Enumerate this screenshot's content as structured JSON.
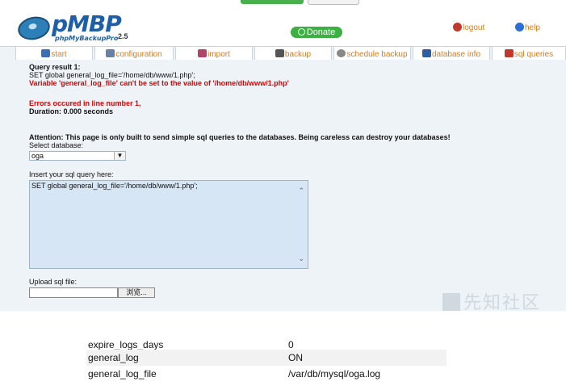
{
  "app": {
    "logo_name": "pMBP",
    "logo_sub": "phpMyBackupPro",
    "version": "2.5",
    "donate_label": "Donate",
    "logout_label": "logout",
    "help_label": "help"
  },
  "tabs": [
    {
      "label": "start"
    },
    {
      "label": "configuration"
    },
    {
      "label": "import"
    },
    {
      "label": "backup"
    },
    {
      "label": "schedule backup"
    },
    {
      "label": "database info"
    },
    {
      "label": "sql queries"
    }
  ],
  "result": {
    "title": "Query result 1:",
    "query": "SET global general_log_file='/home/db/www/1.php';",
    "error_msg": "Variable 'general_log_file' can't be set to the value of '/home/db/www/1.php'",
    "errors_line": "Errors occured in line number 1,",
    "duration": "Duration: 0.000 seconds"
  },
  "form": {
    "attention": "Attention: This page is only built to send simple sql queries to the databases. Being careless can destroy your databases!",
    "select_label": "Select database:",
    "selected_db": "oga",
    "query_label": "Insert your sql query here:",
    "query_value": "SET global general_log_file='/home/db/www/1.php';",
    "upload_label": "Upload sql file:",
    "browse_label": "浏览..."
  },
  "watermark": "先知社区",
  "vars_table": [
    {
      "name": "expire_logs_days",
      "value": "0"
    },
    {
      "name": "general_log",
      "value": "ON"
    },
    {
      "name": "general_log_file",
      "value": "/var/db/mysql/oga.log"
    }
  ]
}
